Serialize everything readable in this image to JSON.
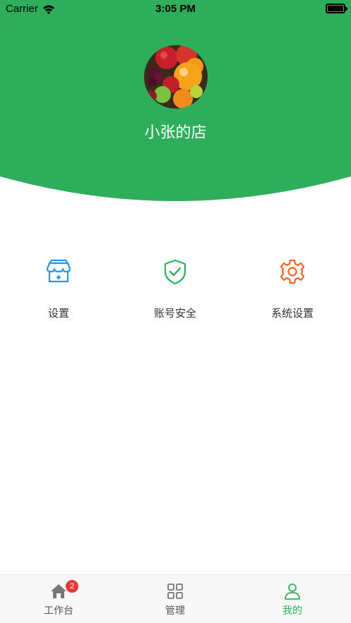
{
  "status_bar": {
    "carrier": "Carrier",
    "time": "3:05 PM"
  },
  "profile": {
    "store_name": "小张的店"
  },
  "menu": {
    "items": [
      {
        "label": "设置",
        "icon": "store-icon",
        "color": "#2196F3"
      },
      {
        "label": "账号安全",
        "icon": "shield-check-icon",
        "color": "#2EAD5A"
      },
      {
        "label": "系统设置",
        "icon": "gear-icon",
        "color": "#F26522"
      }
    ]
  },
  "tabbar": {
    "tabs": [
      {
        "label": "工作台",
        "icon": "home-icon",
        "badge": "2",
        "active": false
      },
      {
        "label": "管理",
        "icon": "grid-icon",
        "active": false
      },
      {
        "label": "我的",
        "icon": "person-icon",
        "active": true
      }
    ]
  },
  "colors": {
    "brand_green": "#2EAD5A",
    "inactive_tab": "#555555",
    "badge_red": "#E53935"
  }
}
